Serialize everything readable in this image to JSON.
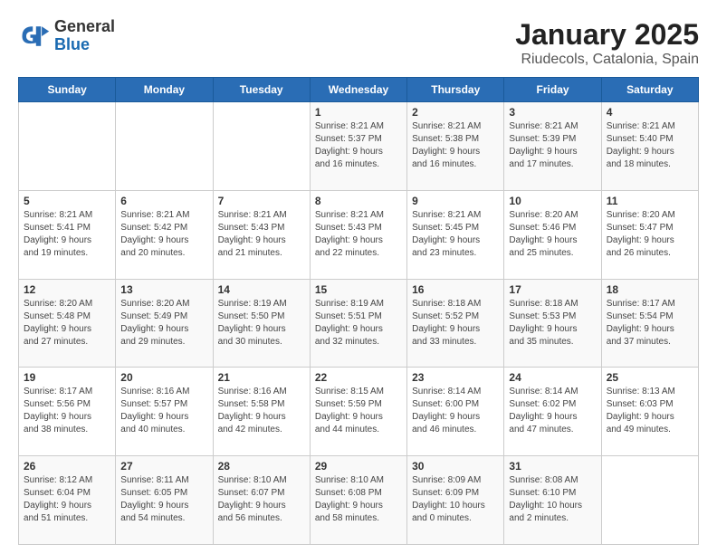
{
  "logo": {
    "general": "General",
    "blue": "Blue"
  },
  "title": "January 2025",
  "subtitle": "Riudecols, Catalonia, Spain",
  "header_days": [
    "Sunday",
    "Monday",
    "Tuesday",
    "Wednesday",
    "Thursday",
    "Friday",
    "Saturday"
  ],
  "weeks": [
    [
      {
        "day": "",
        "info": ""
      },
      {
        "day": "",
        "info": ""
      },
      {
        "day": "",
        "info": ""
      },
      {
        "day": "1",
        "info": "Sunrise: 8:21 AM\nSunset: 5:37 PM\nDaylight: 9 hours\nand 16 minutes."
      },
      {
        "day": "2",
        "info": "Sunrise: 8:21 AM\nSunset: 5:38 PM\nDaylight: 9 hours\nand 16 minutes."
      },
      {
        "day": "3",
        "info": "Sunrise: 8:21 AM\nSunset: 5:39 PM\nDaylight: 9 hours\nand 17 minutes."
      },
      {
        "day": "4",
        "info": "Sunrise: 8:21 AM\nSunset: 5:40 PM\nDaylight: 9 hours\nand 18 minutes."
      }
    ],
    [
      {
        "day": "5",
        "info": "Sunrise: 8:21 AM\nSunset: 5:41 PM\nDaylight: 9 hours\nand 19 minutes."
      },
      {
        "day": "6",
        "info": "Sunrise: 8:21 AM\nSunset: 5:42 PM\nDaylight: 9 hours\nand 20 minutes."
      },
      {
        "day": "7",
        "info": "Sunrise: 8:21 AM\nSunset: 5:43 PM\nDaylight: 9 hours\nand 21 minutes."
      },
      {
        "day": "8",
        "info": "Sunrise: 8:21 AM\nSunset: 5:43 PM\nDaylight: 9 hours\nand 22 minutes."
      },
      {
        "day": "9",
        "info": "Sunrise: 8:21 AM\nSunset: 5:45 PM\nDaylight: 9 hours\nand 23 minutes."
      },
      {
        "day": "10",
        "info": "Sunrise: 8:20 AM\nSunset: 5:46 PM\nDaylight: 9 hours\nand 25 minutes."
      },
      {
        "day": "11",
        "info": "Sunrise: 8:20 AM\nSunset: 5:47 PM\nDaylight: 9 hours\nand 26 minutes."
      }
    ],
    [
      {
        "day": "12",
        "info": "Sunrise: 8:20 AM\nSunset: 5:48 PM\nDaylight: 9 hours\nand 27 minutes."
      },
      {
        "day": "13",
        "info": "Sunrise: 8:20 AM\nSunset: 5:49 PM\nDaylight: 9 hours\nand 29 minutes."
      },
      {
        "day": "14",
        "info": "Sunrise: 8:19 AM\nSunset: 5:50 PM\nDaylight: 9 hours\nand 30 minutes."
      },
      {
        "day": "15",
        "info": "Sunrise: 8:19 AM\nSunset: 5:51 PM\nDaylight: 9 hours\nand 32 minutes."
      },
      {
        "day": "16",
        "info": "Sunrise: 8:18 AM\nSunset: 5:52 PM\nDaylight: 9 hours\nand 33 minutes."
      },
      {
        "day": "17",
        "info": "Sunrise: 8:18 AM\nSunset: 5:53 PM\nDaylight: 9 hours\nand 35 minutes."
      },
      {
        "day": "18",
        "info": "Sunrise: 8:17 AM\nSunset: 5:54 PM\nDaylight: 9 hours\nand 37 minutes."
      }
    ],
    [
      {
        "day": "19",
        "info": "Sunrise: 8:17 AM\nSunset: 5:56 PM\nDaylight: 9 hours\nand 38 minutes."
      },
      {
        "day": "20",
        "info": "Sunrise: 8:16 AM\nSunset: 5:57 PM\nDaylight: 9 hours\nand 40 minutes."
      },
      {
        "day": "21",
        "info": "Sunrise: 8:16 AM\nSunset: 5:58 PM\nDaylight: 9 hours\nand 42 minutes."
      },
      {
        "day": "22",
        "info": "Sunrise: 8:15 AM\nSunset: 5:59 PM\nDaylight: 9 hours\nand 44 minutes."
      },
      {
        "day": "23",
        "info": "Sunrise: 8:14 AM\nSunset: 6:00 PM\nDaylight: 9 hours\nand 46 minutes."
      },
      {
        "day": "24",
        "info": "Sunrise: 8:14 AM\nSunset: 6:02 PM\nDaylight: 9 hours\nand 47 minutes."
      },
      {
        "day": "25",
        "info": "Sunrise: 8:13 AM\nSunset: 6:03 PM\nDaylight: 9 hours\nand 49 minutes."
      }
    ],
    [
      {
        "day": "26",
        "info": "Sunrise: 8:12 AM\nSunset: 6:04 PM\nDaylight: 9 hours\nand 51 minutes."
      },
      {
        "day": "27",
        "info": "Sunrise: 8:11 AM\nSunset: 6:05 PM\nDaylight: 9 hours\nand 54 minutes."
      },
      {
        "day": "28",
        "info": "Sunrise: 8:10 AM\nSunset: 6:07 PM\nDaylight: 9 hours\nand 56 minutes."
      },
      {
        "day": "29",
        "info": "Sunrise: 8:10 AM\nSunset: 6:08 PM\nDaylight: 9 hours\nand 58 minutes."
      },
      {
        "day": "30",
        "info": "Sunrise: 8:09 AM\nSunset: 6:09 PM\nDaylight: 10 hours\nand 0 minutes."
      },
      {
        "day": "31",
        "info": "Sunrise: 8:08 AM\nSunset: 6:10 PM\nDaylight: 10 hours\nand 2 minutes."
      },
      {
        "day": "",
        "info": ""
      }
    ]
  ]
}
